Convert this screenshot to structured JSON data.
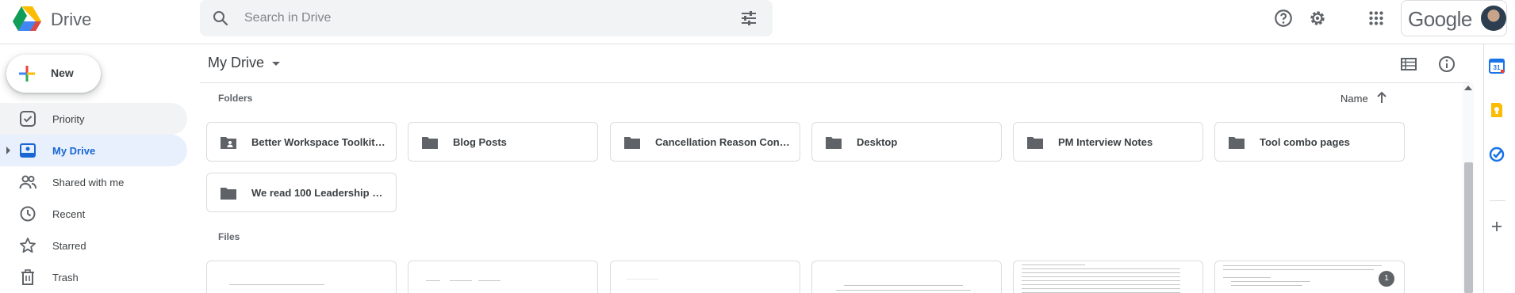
{
  "app": {
    "name": "Drive",
    "brand": "Google"
  },
  "search": {
    "placeholder": "Search in Drive"
  },
  "new_button": {
    "label": "New"
  },
  "sidebar": {
    "items": [
      {
        "label": "Priority",
        "icon": "priority-icon",
        "state": "hover"
      },
      {
        "label": "My Drive",
        "icon": "my-drive-icon",
        "state": "active"
      },
      {
        "label": "Shared with me",
        "icon": "shared-icon",
        "state": ""
      },
      {
        "label": "Recent",
        "icon": "clock-icon",
        "state": ""
      },
      {
        "label": "Starred",
        "icon": "star-icon",
        "state": ""
      },
      {
        "label": "Trash",
        "icon": "trash-icon",
        "state": ""
      }
    ]
  },
  "toolbar": {
    "breadcrumb": "My Drive"
  },
  "content": {
    "folders_title": "Folders",
    "sort_label": "Name",
    "folders": [
      {
        "name": "Better Workspace Toolkit R...",
        "shared": true
      },
      {
        "name": "Blog Posts",
        "shared": false
      },
      {
        "name": "Cancellation Reason Content",
        "shared": false
      },
      {
        "name": "Desktop",
        "shared": false
      },
      {
        "name": "PM Interview Notes",
        "shared": false
      },
      {
        "name": "Tool combo pages",
        "shared": false
      },
      {
        "name": "We read 100 Leadership art...",
        "shared": false
      }
    ],
    "files_title": "Files",
    "file_badge": "1"
  },
  "colors": {
    "active_bg": "#e8f0fe",
    "active_text": "#1967d2",
    "hover_bg": "#f1f3f4",
    "calendar": "#1a73e8",
    "keep": "#fbbc04",
    "tasks": "#1a73e8"
  }
}
